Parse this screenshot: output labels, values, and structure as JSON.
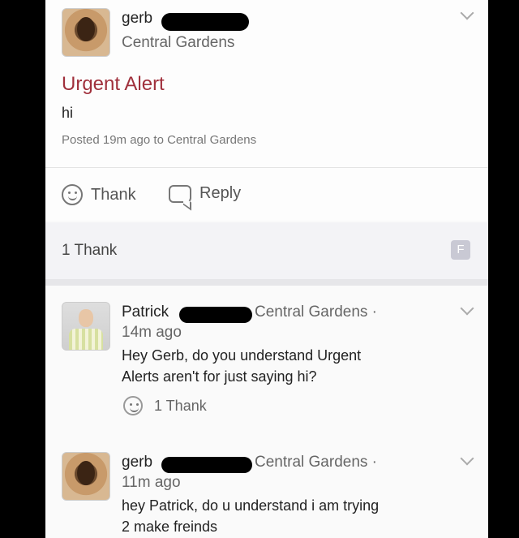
{
  "post": {
    "author": "gerb",
    "neighborhood": "Central Gardens",
    "title": "Urgent Alert",
    "body": "hi",
    "meta": "Posted 19m ago to Central Gardens",
    "thank_label": "Thank",
    "reply_label": "Reply"
  },
  "thanks_bar": {
    "count": "1 Thank",
    "badge": "F"
  },
  "comments": [
    {
      "author": "Patrick",
      "neighborhood": "Central Gardens ·",
      "time": "14m ago",
      "line1": "Hey Gerb, do you understand Urgent",
      "line2": "Alerts aren't for just saying hi?",
      "thanks": "1 Thank"
    },
    {
      "author": "gerb",
      "neighborhood": "Central Gardens ·",
      "time": "11m ago",
      "line1": "hey Patrick, do u understand i am trying",
      "line2": "2 make freinds"
    }
  ]
}
